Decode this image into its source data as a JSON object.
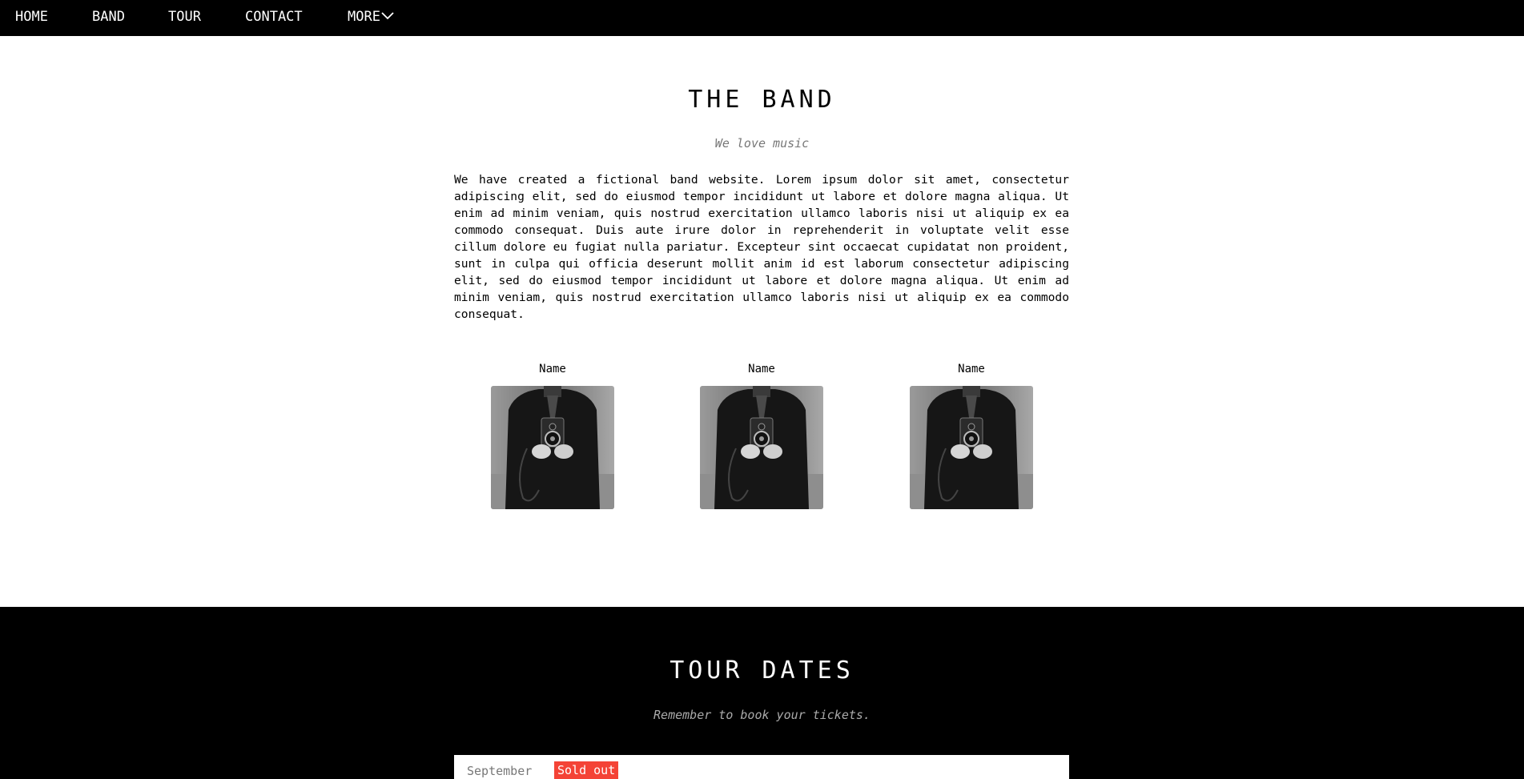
{
  "nav": {
    "home": "HOME",
    "band": "BAND",
    "tour": "TOUR",
    "contact": "CONTACT",
    "more": "MORE",
    "more_icon": "chevron-down-icon"
  },
  "band": {
    "title": "THE BAND",
    "subtitle": "We love music",
    "paragraph": "We have created a fictional band website. Lorem ipsum dolor sit amet, consectetur adipiscing elit, sed do eiusmod tempor incididunt ut labore et dolore magna aliqua. Ut enim ad minim veniam, quis nostrud exercitation ullamco laboris nisi ut aliquip ex ea commodo consequat. Duis aute irure dolor in reprehenderit in voluptate velit esse cillum dolore eu fugiat nulla pariatur. Excepteur sint occaecat cupidatat non proident, sunt in culpa qui officia deserunt mollit anim id est laborum consectetur adipiscing elit, sed do eiusmod tempor incididunt ut labore et dolore magna aliqua. Ut enim ad minim veniam, quis nostrud exercitation ullamco laboris nisi ut aliquip ex ea commodo consequat.",
    "members": [
      {
        "name": "Name"
      },
      {
        "name": "Name"
      },
      {
        "name": "Name"
      }
    ]
  },
  "tour": {
    "title": "TOUR DATES",
    "subtitle": "Remember to book your tickets.",
    "dates": [
      {
        "month": "September",
        "status": "Sold out"
      }
    ]
  },
  "colors": {
    "navbar_bg": "#000000",
    "sold_out_badge": "#f44336",
    "subtitle_gray": "#777777"
  }
}
